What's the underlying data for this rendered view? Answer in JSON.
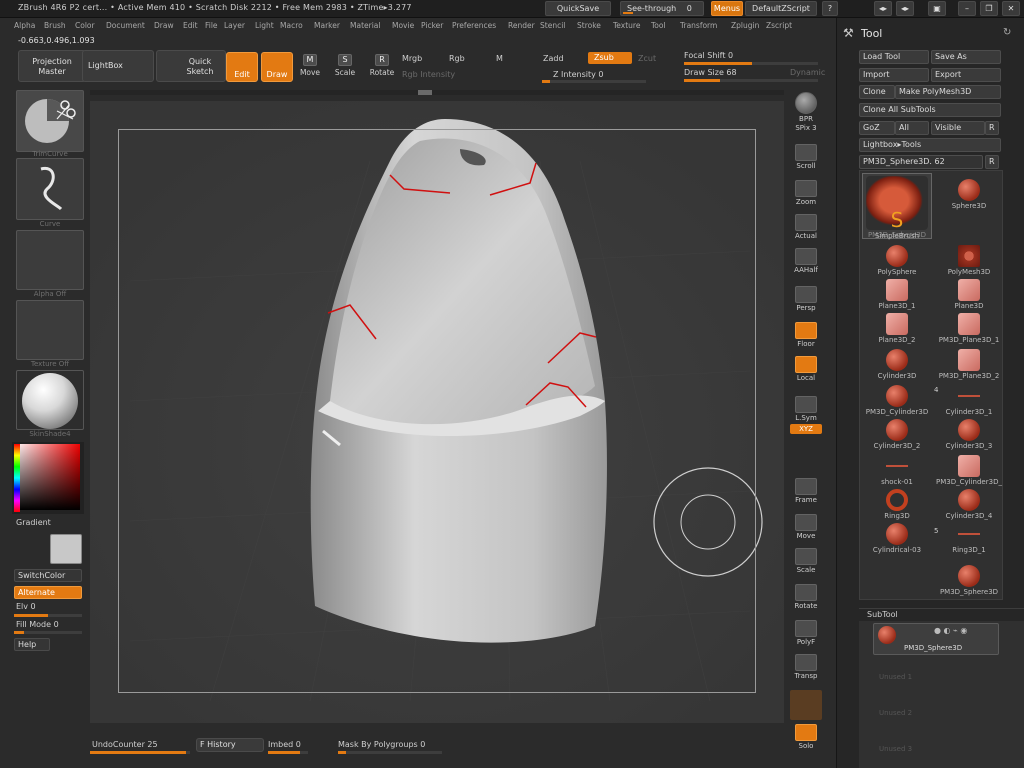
{
  "titlebar": {
    "text": "ZBrush 4R6 P2   cert... • Active Mem 410 • Scratch Disk 2212 • Free Mem 2983 • ZTime▸3.277",
    "quicksave": "QuickSave",
    "seethrough": "See-through",
    "seethrough_value": "0",
    "menus": "Menus",
    "defaultzscript": "DefaultZScript"
  },
  "menubar": [
    "Alpha",
    "Brush",
    "Color",
    "Document",
    "Draw",
    "Edit",
    "File",
    "Layer",
    "Light",
    "Macro",
    "Marker",
    "Material",
    "Movie",
    "Picker",
    "Preferences",
    "Render",
    "Stencil",
    "Stroke",
    "Texture",
    "Tool",
    "Transform",
    "Zplugin",
    "Zscript"
  ],
  "coords": "-0.663,0.496,1.093",
  "toolbar": {
    "projection_master": "Projection Master",
    "lightbox": "LightBox",
    "quick_sketch": "Quick Sketch",
    "edit": "Edit",
    "draw": "Draw",
    "move": "Move",
    "scale": "Scale",
    "rotate": "Rotate",
    "mrgb": "Mrgb",
    "rgb": "Rgb",
    "m": "M",
    "zadd": "Zadd",
    "zsub": "Zsub",
    "zcut": "Zcut",
    "rgb_intensity": "Rgb Intensity",
    "z_intensity": "Z Intensity 0",
    "focal_shift": "Focal Shift 0",
    "draw_size": "Draw Size 68",
    "dynamic": "Dynamic"
  },
  "leftshelf": {
    "brush_label": "TrimCurve",
    "stroke_label": "Curve",
    "alpha_label": "Alpha Off",
    "texture_label": "Texture Off",
    "material_label": "SkinShade4",
    "gradient": "Gradient",
    "switchcolor": "SwitchColor",
    "alternate": "Alternate",
    "elv": "Elv 0",
    "fillmode": "Fill Mode 0",
    "help": "Help"
  },
  "rightshelf": [
    {
      "label": "BPR",
      "icon": "bpr-icon"
    },
    {
      "label": "SPix 3",
      "icon": "spix-icon"
    },
    {
      "label": "Scroll",
      "icon": "scroll-icon"
    },
    {
      "label": "Zoom",
      "icon": "zoom-icon"
    },
    {
      "label": "Actual",
      "icon": "actual-icon"
    },
    {
      "label": "AAHalf",
      "icon": "aahalf-icon"
    },
    {
      "label": "Persp",
      "icon": "persp-icon"
    },
    {
      "label": "Floor",
      "icon": "floor-icon"
    },
    {
      "label": "Local",
      "icon": "local-icon"
    },
    {
      "label": "L.Sym",
      "icon": "lsym-icon"
    },
    {
      "label": "XYZ",
      "icon": "xyz-icon"
    },
    {
      "label": "Frame",
      "icon": "frame-icon"
    },
    {
      "label": "Move",
      "icon": "move-icon"
    },
    {
      "label": "Scale",
      "icon": "scale-icon"
    },
    {
      "label": "Rotate",
      "icon": "rotate-icon"
    },
    {
      "label": "PolyF",
      "icon": "polyf-icon"
    },
    {
      "label": "Transp",
      "icon": "transp-icon"
    },
    {
      "label": "Solo",
      "icon": "solo-icon"
    }
  ],
  "bottombar": {
    "undocounter": "UndoCounter 25",
    "fhistory": "F History",
    "imbed": "Imbed 0",
    "maskbypolygroups": "Mask By Polygroups 0"
  },
  "toolpanel": {
    "title": "Tool",
    "load_tool": "Load Tool",
    "save_as": "Save As",
    "import": "Import",
    "export": "Export",
    "clone": "Clone",
    "make_polymesh": "Make PolyMesh3D",
    "clone_all": "Clone All SubTools",
    "goz": "GoZ",
    "all": "All",
    "visible": "Visible",
    "r": "R",
    "lightbox_tools": "Lightbox▸Tools",
    "current_tool": "PM3D_Sphere3D. 62",
    "tools": [
      {
        "name": "PM3D_Sphere3D",
        "shape": "big"
      },
      {
        "name": "Sphere3D",
        "shape": "ball"
      },
      {
        "name": "SimpleBrush",
        "shape": "s"
      },
      {
        "name": "PolyMesh3D",
        "shape": "star"
      },
      {
        "name": "PolySphere",
        "shape": "ball"
      },
      {
        "name": "Plane3D",
        "shape": "sq"
      },
      {
        "name": "Plane3D_1",
        "shape": "sq"
      },
      {
        "name": "PM3D_Plane3D_1",
        "shape": "sq"
      },
      {
        "name": "Plane3D_2",
        "shape": "sq"
      },
      {
        "name": "PM3D_Plane3D_2",
        "shape": "sq"
      },
      {
        "name": "Cylinder3D",
        "shape": "ball"
      },
      {
        "name": "Cylinder3D_1",
        "shape": "line"
      },
      {
        "name": "PM3D_Cylinder3D",
        "shape": "ball"
      },
      {
        "name": "Cylinder3D_3",
        "shape": "ball"
      },
      {
        "name": "Cylinder3D_2",
        "shape": "ball"
      },
      {
        "name": "PM3D_Cylinder3D_",
        "shape": "sq"
      },
      {
        "name": "shock-01",
        "shape": "line"
      },
      {
        "name": "Cylinder3D_4",
        "shape": "ball"
      },
      {
        "name": "Ring3D",
        "shape": "ring"
      },
      {
        "name": "Ring3D_1",
        "shape": "line"
      },
      {
        "name": "Cylindrical-03",
        "shape": "ball"
      },
      {
        "name": "PM3D_Sphere3D",
        "shape": "ball"
      }
    ],
    "count_4": "4",
    "count_5": "5",
    "subtool": "SubTool",
    "subtool_item": "PM3D_Sphere3D",
    "subslots": [
      "Unused 1",
      "Unused 2",
      "Unused 3"
    ]
  }
}
